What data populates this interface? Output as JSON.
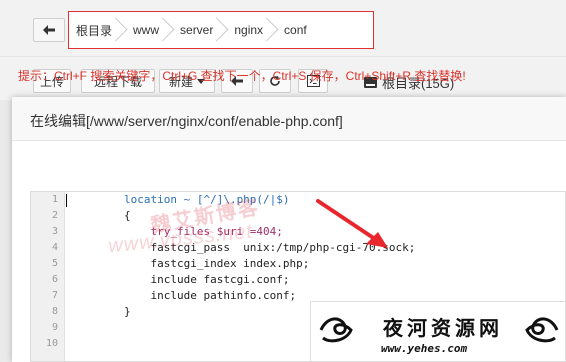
{
  "breadcrumb": {
    "items": [
      "根目录",
      "www",
      "server",
      "nginx",
      "conf"
    ]
  },
  "toolbar": {
    "upload": "上传",
    "remote_download": "远程下载",
    "new": "新建",
    "disk_label": "根目录(15G)"
  },
  "modal": {
    "title": "在线编辑[/www/server/nginx/conf/enable-php.conf]",
    "tip": "提示：Ctrl+F 搜索关键字，Ctrl+G 查找下一个，Ctrl+S 保存，Ctrl+Shift+R 查找替换!"
  },
  "editor": {
    "line_numbers": [
      "1",
      "2",
      "3",
      "4",
      "5",
      "6",
      "7",
      "8",
      "9",
      "10"
    ],
    "lines": [
      "        location ~ [^/]\\.php(/|$)",
      "        {",
      "            try_files $uri =404;",
      "            fastcgi_pass  unix:/tmp/php-cgi-70.sock;",
      "            fastcgi_index index.php;",
      "            include fastcgi.conf;",
      "            include pathinfo.conf;",
      "        }",
      "",
      ""
    ]
  },
  "watermark": {
    "text1": "魏艾斯博客",
    "text2": "www.vpsss.net"
  },
  "stamp": {
    "title": "夜河资源网",
    "url": "www.yehes.com"
  },
  "colors": {
    "tip": "#d9342b",
    "breadcrumb_highlight": "#e03030",
    "arrow": "#e8262b"
  }
}
